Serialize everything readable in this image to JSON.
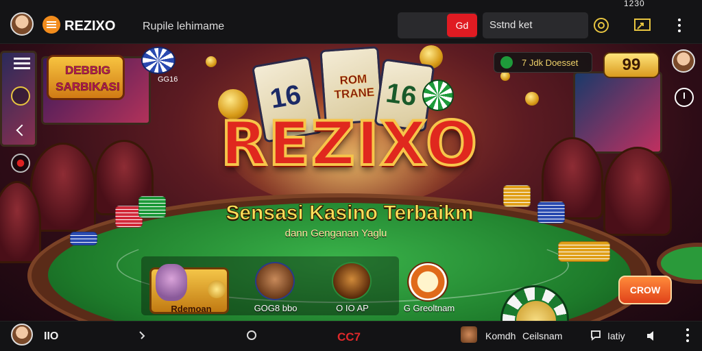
{
  "topbar": {
    "brand": "REZIXO",
    "subtitle": "Rupile lehimame",
    "go_button": "Gd",
    "search_value": "Sstnd ket",
    "status": "1230"
  },
  "hero": {
    "title": "REZIXO",
    "tagline": "Sensasi Kasino Terbaikm",
    "tagline_sub": "dann Genganan Yaglu",
    "badge_text_line1": "DEBBIG",
    "badge_text_line2": "SARBIKASI",
    "chip_caption": "GG16",
    "card_left_number": "16",
    "card_mid_text": "ROM TRANE",
    "card_right_number": "16"
  },
  "right_rail": {
    "notice": "7 Jdk Doesset",
    "balance": "99"
  },
  "games": [
    {
      "label": "Rdemoan"
    },
    {
      "label": "GOG8 bbo"
    },
    {
      "label": "O IO AP"
    },
    {
      "label": "G Greoltnam"
    }
  ],
  "cta": {
    "label": "CROW"
  },
  "bottombar": {
    "user_count": "IIO",
    "center_label": "CC7",
    "item_left": "Komdh",
    "item_mid": "Ceilsnam",
    "item_right": "Iatiy"
  },
  "colors": {
    "accent_red": "#e01b22",
    "accent_gold": "#f7c54a",
    "felt_green": "#2a9a3a"
  }
}
